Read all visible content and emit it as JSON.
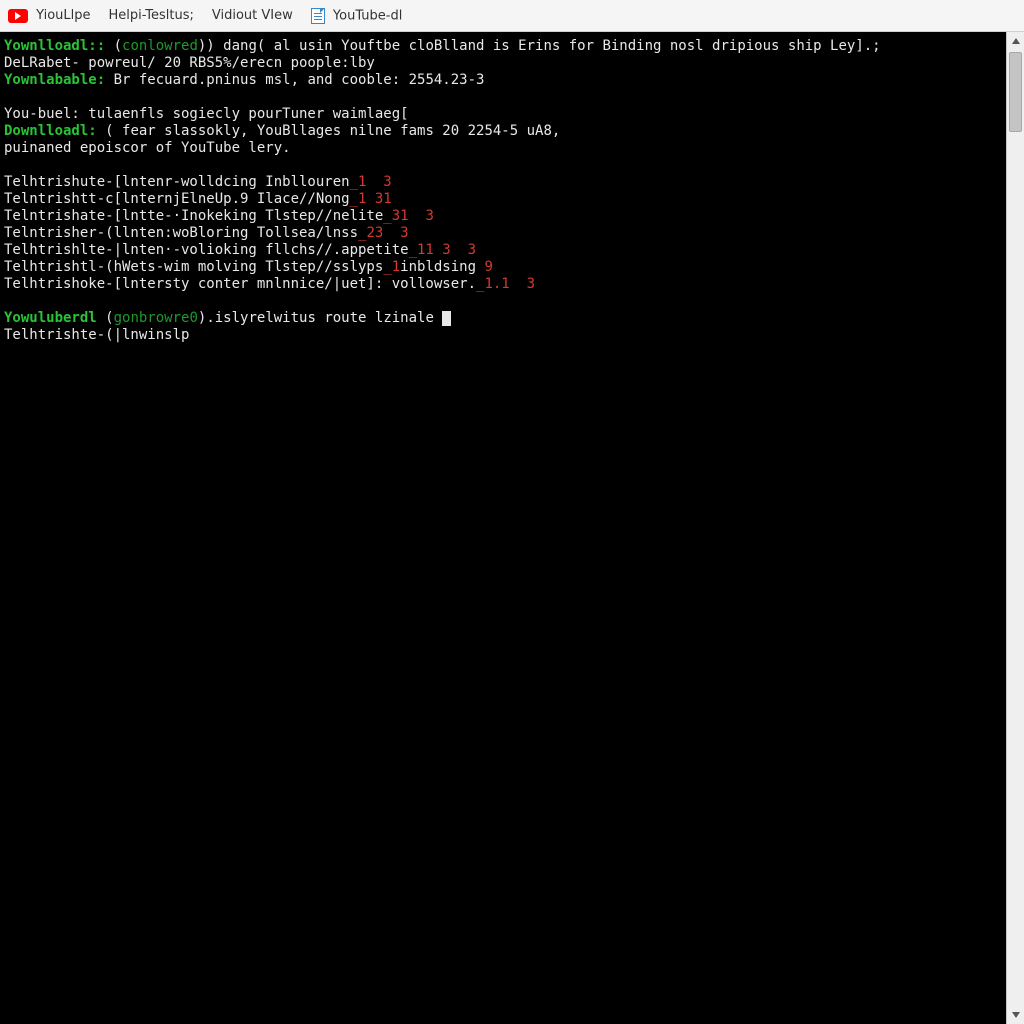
{
  "menubar": {
    "items": [
      {
        "label": "YiouLlpe"
      },
      {
        "label": "Helpi-Tesltus;"
      },
      {
        "label": "Vidiout VIew"
      },
      {
        "label": "YouTube-dl"
      }
    ]
  },
  "terminal": {
    "lines": [
      {
        "segments": [
          {
            "cls": "g",
            "text": "Yownlloadl:: "
          },
          {
            "cls": "w",
            "text": "("
          },
          {
            "cls": "gd",
            "text": "conlowred"
          },
          {
            "cls": "w",
            "text": ")) dang( al usin Youftbe cloBlland is Erins for Binding nosl dripious ship Ley].;"
          }
        ]
      },
      {
        "segments": [
          {
            "cls": "w",
            "text": "DeLRabet- powreul/ 20 RBS5%/erecn poople:lby"
          }
        ]
      },
      {
        "segments": [
          {
            "cls": "g",
            "text": "Yownlabable: "
          },
          {
            "cls": "w",
            "text": "Br fecuard.pninus msl, and cooble: 2554.23-3"
          }
        ]
      },
      {
        "segments": [
          {
            "cls": "w",
            "text": " "
          }
        ]
      },
      {
        "segments": [
          {
            "cls": "w",
            "text": "You-buel: tulaenfls sogiecly pourTuner waimlaeg["
          }
        ]
      },
      {
        "segments": [
          {
            "cls": "g",
            "text": "Downlloadl: "
          },
          {
            "cls": "w",
            "text": "( fear slassokly, YouBllages nilne fams 20 2254-5 uA8,"
          }
        ]
      },
      {
        "segments": [
          {
            "cls": "w",
            "text": "puinaned epoiscor of YouTube lery."
          }
        ]
      },
      {
        "segments": [
          {
            "cls": "w",
            "text": " "
          }
        ]
      },
      {
        "segments": [
          {
            "cls": "w",
            "text": "Telhtrishute-[lntenr-wolldcing Inbllouren"
          },
          {
            "cls": "r",
            "text": "_1  3"
          }
        ]
      },
      {
        "segments": [
          {
            "cls": "w",
            "text": "Telntrishtt-c[lnternjElneUp.9 Ilace//Nong"
          },
          {
            "cls": "r",
            "text": "_1 31"
          }
        ]
      },
      {
        "segments": [
          {
            "cls": "w",
            "text": "Telntrishate-[lntte-·Inokeking Tlstep//nelite"
          },
          {
            "cls": "r",
            "text": "_31  3"
          }
        ]
      },
      {
        "segments": [
          {
            "cls": "w",
            "text": "Telntrisher-(llnten:woBloring Tollsea/lnss"
          },
          {
            "cls": "r",
            "text": "_23  3"
          }
        ]
      },
      {
        "segments": [
          {
            "cls": "w",
            "text": "Telhtrishlte-|lnten·-volioking fllchs//.appetite"
          },
          {
            "cls": "r",
            "text": "_11 3  3"
          }
        ]
      },
      {
        "segments": [
          {
            "cls": "w",
            "text": "Telhtrishtl-(hWets-wim molving Tlstep//sslyps"
          },
          {
            "cls": "r",
            "text": "_1"
          },
          {
            "cls": "w",
            "text": "inbldsing "
          },
          {
            "cls": "r",
            "text": "9"
          }
        ]
      },
      {
        "segments": [
          {
            "cls": "w",
            "text": "Telhtrishoke-[lntersty conter mnlnnice/|uet]: vollowser."
          },
          {
            "cls": "r",
            "text": "_1.1  3"
          }
        ]
      },
      {
        "segments": [
          {
            "cls": "w",
            "text": " "
          }
        ]
      },
      {
        "segments": [
          {
            "cls": "g",
            "text": "Yowuluberdl "
          },
          {
            "cls": "w",
            "text": "("
          },
          {
            "cls": "gd",
            "text": "gonbrowre0"
          },
          {
            "cls": "w",
            "text": ").islyrelwitus route lzinale "
          },
          {
            "cls": "cursor",
            "text": ""
          }
        ]
      },
      {
        "segments": [
          {
            "cls": "w",
            "text": "Telhtrishte-(|lnwinslp"
          }
        ]
      }
    ]
  }
}
